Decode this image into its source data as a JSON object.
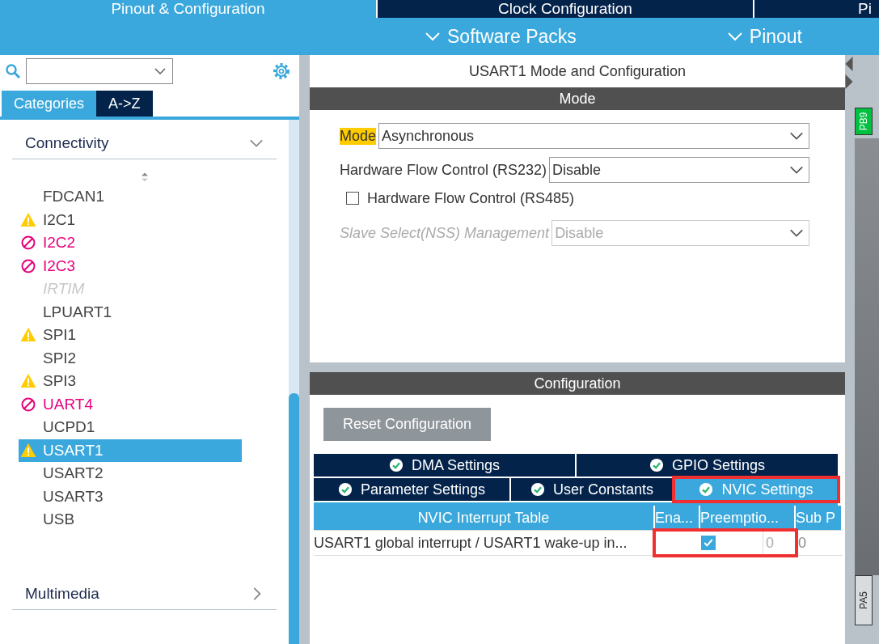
{
  "top_tabs": [
    {
      "label": "Pinout & Configuration",
      "selected": true
    },
    {
      "label": "Clock Configuration",
      "selected": false
    },
    {
      "label": "Pi",
      "selected": false
    }
  ],
  "sub_menu": [
    {
      "label": "Software Packs"
    },
    {
      "label": "Pinout"
    }
  ],
  "sidebar": {
    "tabs": [
      {
        "label": "Categories",
        "selected": true
      },
      {
        "label": "A->Z",
        "selected": false
      }
    ],
    "categories": [
      {
        "label": "Connectivity",
        "expanded": true,
        "items": [
          {
            "label": "FDCAN1",
            "kind": "ok",
            "selected": false
          },
          {
            "label": "I2C1",
            "kind": "warning",
            "selected": false
          },
          {
            "label": "I2C2",
            "kind": "error",
            "selected": false
          },
          {
            "label": "I2C3",
            "kind": "error",
            "selected": false
          },
          {
            "label": "IRTIM",
            "kind": "disabled",
            "selected": false
          },
          {
            "label": "LPUART1",
            "kind": "ok",
            "selected": false
          },
          {
            "label": "SPI1",
            "kind": "warning",
            "selected": false
          },
          {
            "label": "SPI2",
            "kind": "ok",
            "selected": false
          },
          {
            "label": "SPI3",
            "kind": "warning",
            "selected": false
          },
          {
            "label": "UART4",
            "kind": "error",
            "selected": false
          },
          {
            "label": "UCPD1",
            "kind": "ok",
            "selected": false
          },
          {
            "label": "USART1",
            "kind": "warning",
            "selected": true
          },
          {
            "label": "USART2",
            "kind": "ok",
            "selected": false
          },
          {
            "label": "USART3",
            "kind": "ok",
            "selected": false
          },
          {
            "label": "USB",
            "kind": "ok",
            "selected": false
          }
        ]
      },
      {
        "label": "Multimedia",
        "expanded": false
      }
    ]
  },
  "mode_panel": {
    "title": "USART1 Mode and Configuration",
    "header": "Mode",
    "fields": [
      {
        "kind": "select",
        "label": "Mode",
        "value": "Asynchronous",
        "label_highlighted": true,
        "disabled": false
      },
      {
        "kind": "select",
        "label": "Hardware Flow Control (RS232)",
        "value": "Disable",
        "label_highlighted": false,
        "disabled": false
      },
      {
        "kind": "checkbox",
        "label": "Hardware Flow Control (RS485)",
        "checked": false
      },
      {
        "kind": "select",
        "label": "Slave Select(NSS) Management",
        "value": "Disable",
        "label_highlighted": false,
        "disabled": true
      }
    ]
  },
  "config_panel": {
    "header": "Configuration",
    "reset_button": "Reset Configuration",
    "tab_rows": [
      [
        {
          "label": "DMA Settings",
          "selected": false,
          "annotated": false
        },
        {
          "label": "GPIO Settings",
          "selected": false,
          "annotated": false
        }
      ],
      [
        {
          "label": "Parameter Settings",
          "selected": false,
          "annotated": false
        },
        {
          "label": "User Constants",
          "selected": false,
          "annotated": false
        },
        {
          "label": "NVIC Settings",
          "selected": true,
          "annotated": true
        }
      ]
    ],
    "table": {
      "columns": [
        "NVIC Interrupt Table",
        "Ena...",
        "Preemptio...",
        "Sub P"
      ],
      "rows": [
        {
          "name": "USART1 global interrupt / USART1 wake-up in...",
          "enabled": true,
          "preemption": "0",
          "sub_priority": "0",
          "annotated": true
        }
      ]
    }
  },
  "chip_pins": [
    {
      "label": "PB9",
      "color": "#00c040"
    },
    {
      "label": "PA5",
      "color": "#d8dcdf"
    }
  ]
}
